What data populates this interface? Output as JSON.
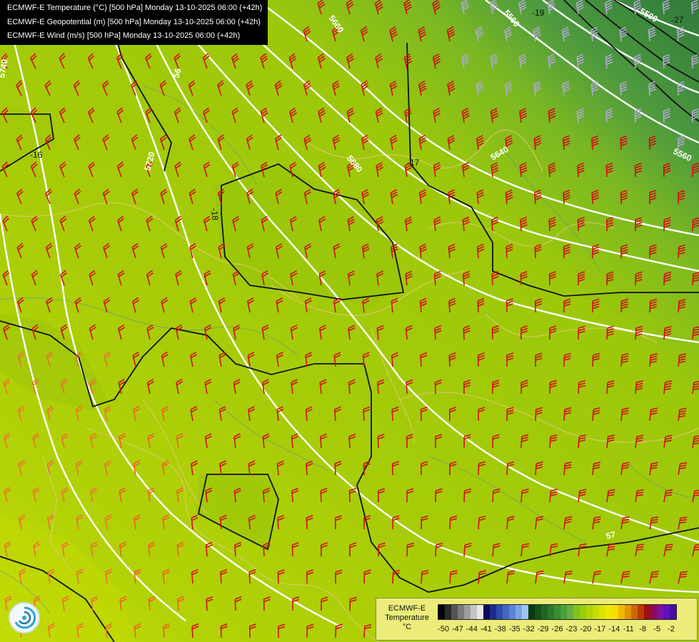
{
  "titles": [
    "ECMWF-E Temperature (°C) [500 hPa] Monday 13-10-2025 06:00 (+42h)",
    "ECMWF-E Geopotential (m) [500 hPa] Monday 13-10-2025 06:00 (+42h)",
    "ECMWF-E Wind (m/s) [500 hPa] Monday 13-10-2025 06:00 (+42h)"
  ],
  "legend": {
    "title_line1": "ECMWF-E",
    "title_line2": "Temperature",
    "unit": "°C",
    "tick_labels": [
      "-50",
      "-47",
      "-44",
      "-41",
      "-38",
      "-35",
      "-32",
      "-29",
      "-26",
      "-23",
      "-20",
      "-17",
      "-14",
      "-11",
      "-8",
      "-5",
      "-2"
    ],
    "colors": [
      "#050505",
      "#2a2a2a",
      "#555555",
      "#7a7a7a",
      "#9e9e9e",
      "#c4c4c4",
      "#e8e8e8",
      "#0a0a5a",
      "#1c2a8c",
      "#2e48ad",
      "#4466c4",
      "#5a84d6",
      "#78a4e6",
      "#9cc4f4",
      "#0a3a0a",
      "#14501a",
      "#1e6626",
      "#2a7a2e",
      "#3a8e36",
      "#4aa03c",
      "#62b040",
      "#7ec21c",
      "#98cc0c",
      "#b2d406",
      "#c8dc04",
      "#dce404",
      "#eee800",
      "#f8dc00",
      "#f0b800",
      "#e09400",
      "#cc6a00",
      "#b83c00",
      "#a01010",
      "#8c0a5a",
      "#7a14a0",
      "#6010c0",
      "#4a0ca0"
    ]
  },
  "map": {
    "geopotential_labels": [
      "5660",
      "5560",
      "5500",
      "5740",
      "5720",
      "5680",
      "5640",
      "57",
      "5560",
      "56"
    ],
    "temperature_labels": [
      "-16",
      "-18",
      "-17",
      "-19",
      "-27"
    ]
  }
}
